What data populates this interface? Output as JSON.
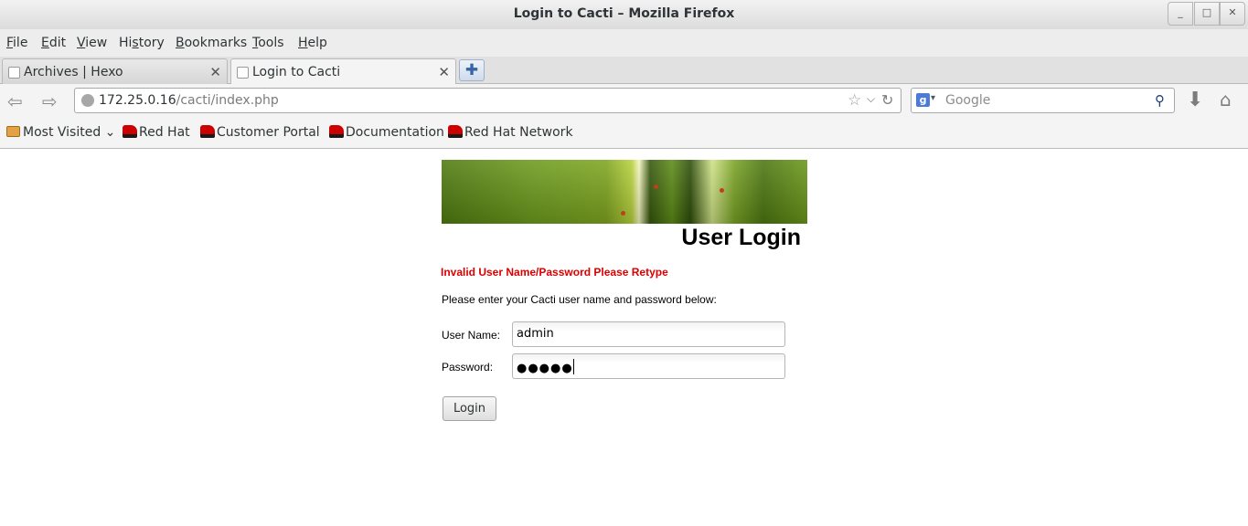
{
  "window": {
    "title": "Login to Cacti – Mozilla Firefox",
    "minimize_glyph": "_",
    "maximize_glyph": "□",
    "close_glyph": "✕"
  },
  "menubar": {
    "items": [
      {
        "accel": "F",
        "rest": "ile"
      },
      {
        "accel": "E",
        "rest": "dit"
      },
      {
        "accel": "V",
        "rest": "iew"
      },
      {
        "pre": "Hi",
        "accel": "s",
        "rest": "tory"
      },
      {
        "accel": "B",
        "rest": "ookmarks"
      },
      {
        "accel": "T",
        "rest": "ools"
      },
      {
        "accel": "H",
        "rest": "elp"
      }
    ]
  },
  "tabs": [
    {
      "label": "Archives | Hexo",
      "close": "✕",
      "active": false
    },
    {
      "label": "Login to Cacti",
      "close": "✕",
      "active": true
    }
  ],
  "new_tab_glyph": "✚",
  "navbar": {
    "back_glyph": "⇦",
    "forward_glyph": "⇨",
    "url_host": "172.25.0.16",
    "url_path": "/cacti/index.php",
    "star_glyph": "☆",
    "dropdown_glyph": "⌵",
    "reload_glyph": "↻",
    "search_engine_glyph": "g",
    "search_dropdown_glyph": "▾",
    "search_placeholder": "Google",
    "search_go_glyph": "⚲",
    "download_glyph": "⬇",
    "home_glyph": "⌂"
  },
  "bookmarks": [
    {
      "label": "Most Visited",
      "icon": "folder-icon",
      "suffix": "⌄"
    },
    {
      "label": "Red Hat",
      "icon": "redhat-icon"
    },
    {
      "label": "Customer Portal",
      "icon": "redhat-icon"
    },
    {
      "label": "Documentation",
      "icon": "redhat-icon"
    },
    {
      "label": "Red Hat Network",
      "icon": "redhat-icon"
    }
  ],
  "page": {
    "heading": "User Login",
    "error": "Invalid User Name/Password Please Retype",
    "instructions": "Please enter your Cacti user name and password below:",
    "username_label": "User Name:",
    "username_value": "admin",
    "password_label": "Password:",
    "password_mask": "●●●●●",
    "login_button": "Login",
    "error_color": "#dd0000"
  }
}
